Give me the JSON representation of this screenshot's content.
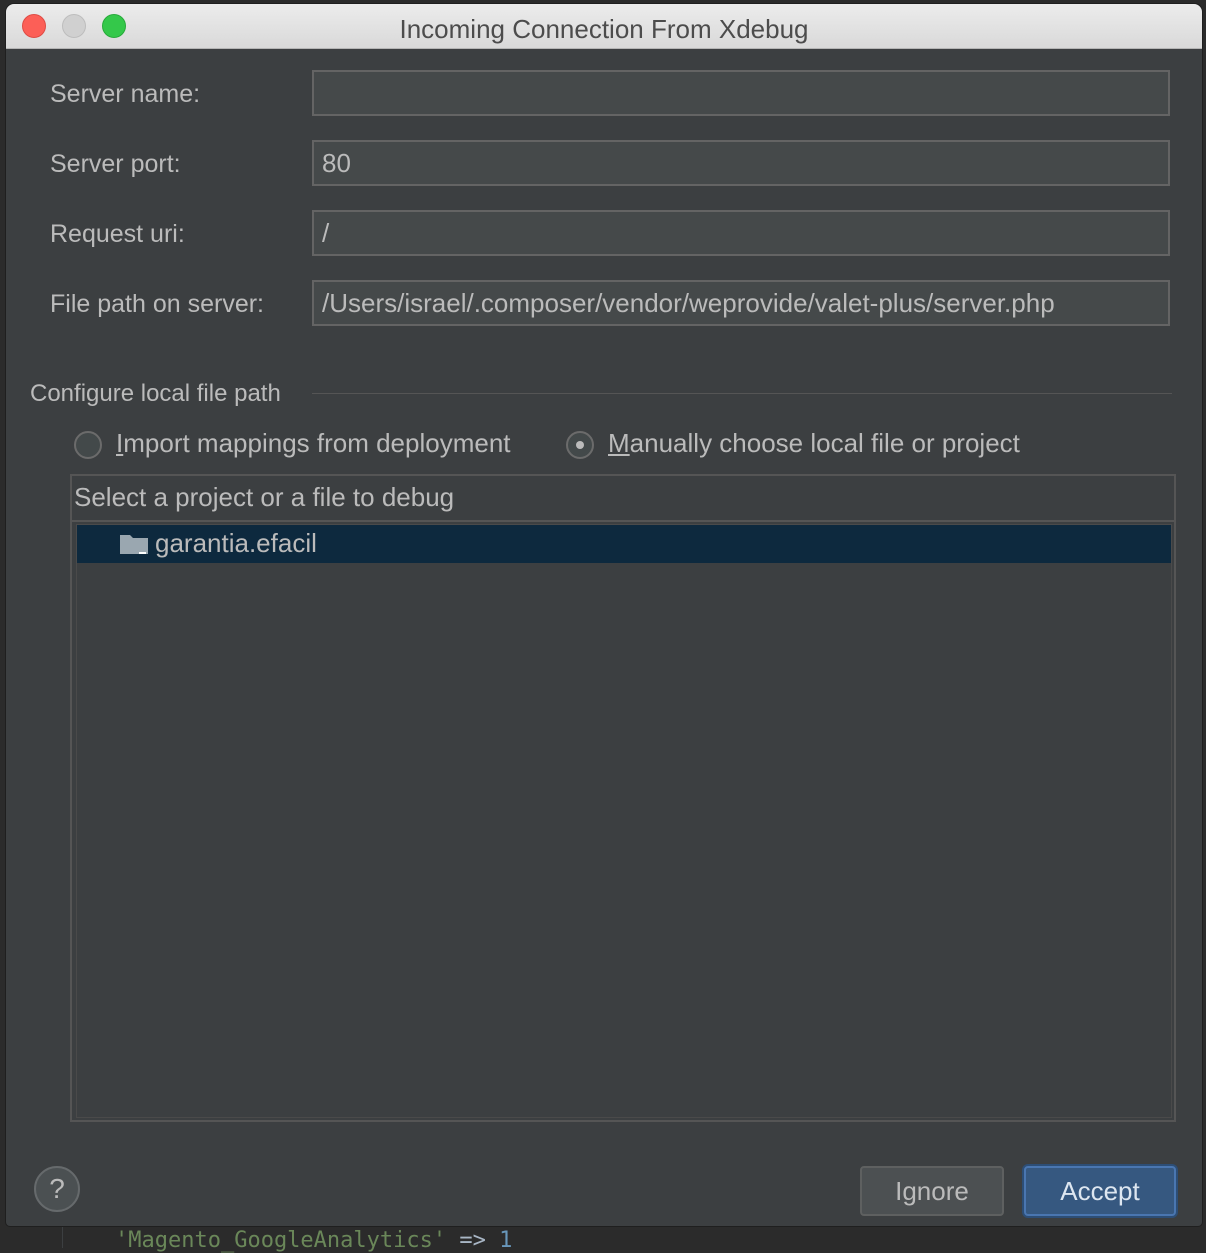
{
  "background": {
    "code_string": "'Magento_GoogleAnalytics'",
    "code_operator": "=>",
    "code_value": "1"
  },
  "window": {
    "title": "Incoming Connection From Xdebug"
  },
  "form": {
    "server_name_label": "Server name:",
    "server_name_value": "",
    "server_port_label": "Server port:",
    "server_port_value": "80",
    "request_uri_label": "Request uri:",
    "request_uri_value": "/",
    "file_path_label": "File path on server:",
    "file_path_value": "/Users/israel/.composer/vendor/weprovide/valet-plus/server.php"
  },
  "section": {
    "title": "Configure local file path"
  },
  "options": {
    "import_mnemonic": "I",
    "import_rest": "mport mappings from deployment",
    "import_selected": false,
    "manual_mnemonic": "M",
    "manual_rest": "anually choose local file or project",
    "manual_selected": true
  },
  "tree": {
    "header": "Select a project or a file to debug",
    "items": [
      {
        "label": "garantia.efacil",
        "icon": "folder-icon",
        "selected": true
      }
    ]
  },
  "buttons": {
    "help_label": "?",
    "ignore_label": "Ignore",
    "accept_label": "Accept"
  },
  "colors": {
    "dialog_bg": "#3c3f41",
    "selection_bg": "#0d293e",
    "accent_button": "#365880",
    "close": "#fc5f57",
    "maximize": "#34c84a"
  }
}
